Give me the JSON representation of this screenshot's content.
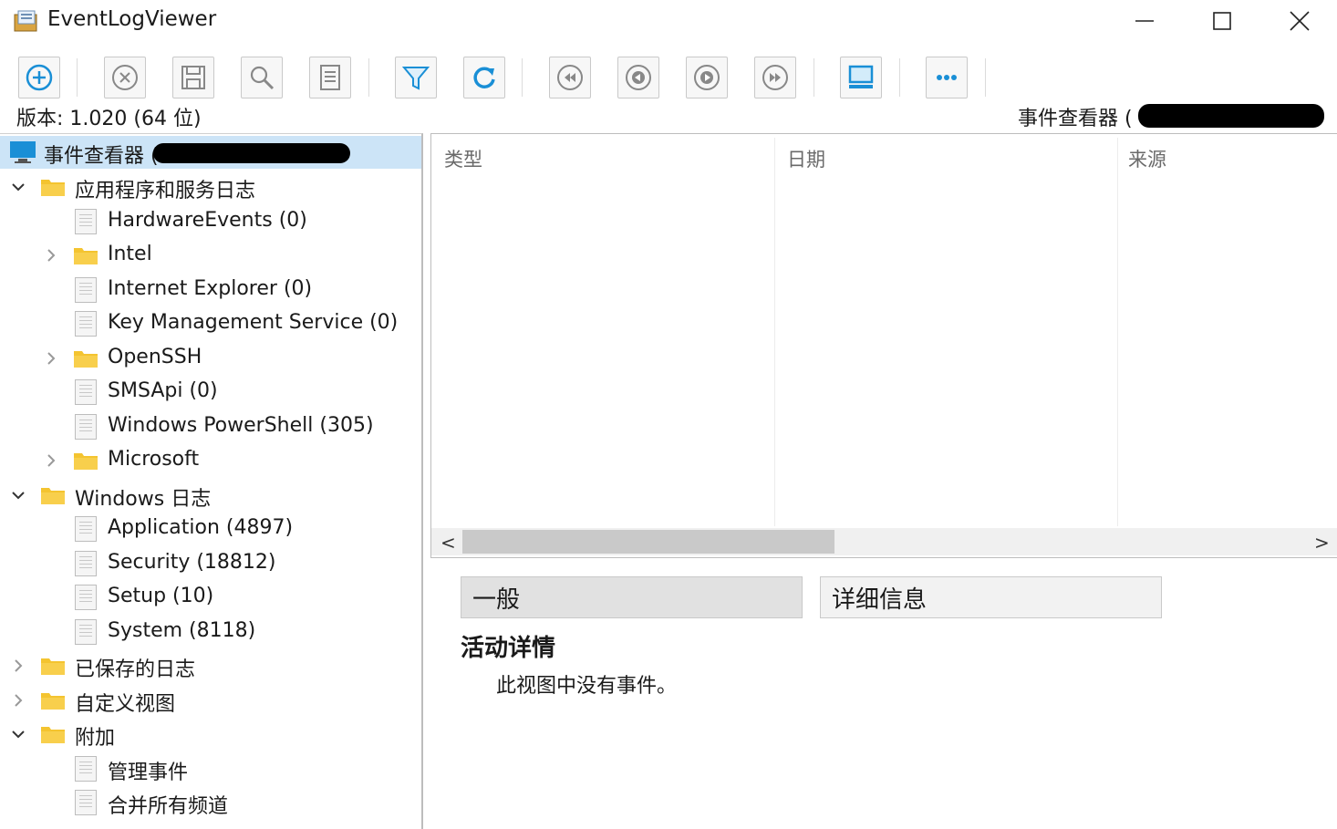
{
  "window": {
    "title": "EventLogViewer",
    "minimize_icon": "minimize-icon",
    "maximize_icon": "maximize-icon",
    "close_icon": "close-icon"
  },
  "toolbar": {
    "buttons": [
      {
        "name": "add-button",
        "icon": "plus-circle-icon"
      },
      {
        "name": "clear-button",
        "icon": "x-circle-icon"
      },
      {
        "name": "save-button",
        "icon": "floppy-disk-icon"
      },
      {
        "name": "find-button",
        "icon": "magnifier-icon"
      },
      {
        "name": "properties-button",
        "icon": "list-document-icon"
      },
      {
        "name": "filter-button",
        "icon": "funnel-icon"
      },
      {
        "name": "refresh-button",
        "icon": "refresh-icon"
      },
      {
        "name": "first-button",
        "icon": "rewind-icon"
      },
      {
        "name": "previous-button",
        "icon": "previous-icon"
      },
      {
        "name": "next-button",
        "icon": "next-icon"
      },
      {
        "name": "last-button",
        "icon": "fast-forward-icon"
      },
      {
        "name": "computer-button",
        "icon": "computer-icon"
      },
      {
        "name": "more-button",
        "icon": "ellipsis-icon"
      }
    ]
  },
  "version_label": "版本: 1.020 (64 位)",
  "viewer_label": "事件查看器 (",
  "tree": {
    "root": "事件查看器 (",
    "items": [
      {
        "label": "应用程序和服务日志",
        "kind": "folder",
        "expanded": true
      },
      {
        "label": "HardwareEvents (0)",
        "kind": "log"
      },
      {
        "label": "Intel",
        "kind": "folder",
        "expanded": false
      },
      {
        "label": "Internet Explorer (0)",
        "kind": "log"
      },
      {
        "label": "Key Management Service (0)",
        "kind": "log"
      },
      {
        "label": "OpenSSH",
        "kind": "folder",
        "expanded": false
      },
      {
        "label": "SMSApi (0)",
        "kind": "log"
      },
      {
        "label": "Windows PowerShell (305)",
        "kind": "log"
      },
      {
        "label": "Microsoft",
        "kind": "folder",
        "expanded": false
      },
      {
        "label": "Windows 日志",
        "kind": "folder",
        "expanded": true
      },
      {
        "label": "Application (4897)",
        "kind": "log"
      },
      {
        "label": "Security (18812)",
        "kind": "log"
      },
      {
        "label": "Setup (10)",
        "kind": "log"
      },
      {
        "label": "System (8118)",
        "kind": "log"
      },
      {
        "label": "已保存的日志",
        "kind": "folder",
        "expanded": false
      },
      {
        "label": "自定义视图",
        "kind": "folder",
        "expanded": false
      },
      {
        "label": "附加",
        "kind": "folder",
        "expanded": true
      },
      {
        "label": "管理事件",
        "kind": "log"
      },
      {
        "label": "合并所有频道",
        "kind": "log"
      }
    ]
  },
  "grid": {
    "columns": [
      "类型",
      "日期",
      "来源"
    ]
  },
  "details": {
    "tab_general": "一般",
    "tab_detail": "详细信息",
    "title": "活动详情",
    "empty_message": "此视图中没有事件。"
  },
  "colors": {
    "selection": "#cce4f7",
    "accent_blue": "#1a8fd6",
    "folder_yellow": "#f4c430"
  }
}
